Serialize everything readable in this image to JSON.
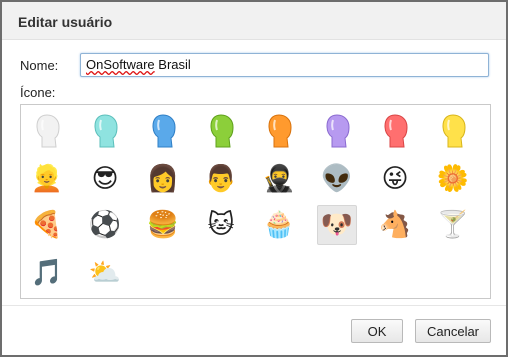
{
  "dialog": {
    "title": "Editar usuário",
    "name_label": "Nome:",
    "name_value_first": "OnSoftware",
    "name_value_rest": " Brasil",
    "icon_label": "Ícone:",
    "ok_label": "OK",
    "cancel_label": "Cancelar"
  },
  "icons": {
    "heads": [
      {
        "name": "avatar-white-head-icon",
        "color": "#f2f2f2",
        "shade": "#cfcfcf"
      },
      {
        "name": "avatar-teal-head-icon",
        "color": "#8fe3e0",
        "shade": "#5cbfbb"
      },
      {
        "name": "avatar-blue-head-icon",
        "color": "#5aa9ea",
        "shade": "#2f7fc6"
      },
      {
        "name": "avatar-green-head-icon",
        "color": "#8ccf3a",
        "shade": "#5fa11c"
      },
      {
        "name": "avatar-orange-head-icon",
        "color": "#ff9a2e",
        "shade": "#d8720c"
      },
      {
        "name": "avatar-purple-head-icon",
        "color": "#b79af0",
        "shade": "#8b6bd0"
      },
      {
        "name": "avatar-red-head-icon",
        "color": "#ff6f6f",
        "shade": "#d94545"
      },
      {
        "name": "avatar-yellow-head-icon",
        "color": "#ffe14a",
        "shade": "#d8b51a"
      }
    ],
    "row2": [
      {
        "name": "blonde-woman-sunglasses-icon",
        "glyph": "👱"
      },
      {
        "name": "cool-guy-cap-icon",
        "glyph": "😎"
      },
      {
        "name": "woman-sunglasses-icon",
        "glyph": "👩"
      },
      {
        "name": "man-portrait-icon",
        "glyph": "👨"
      },
      {
        "name": "ninja-icon",
        "glyph": "🥷"
      },
      {
        "name": "alien-icon",
        "glyph": "👽"
      },
      {
        "name": "laughing-smiley-icon",
        "glyph": "😜"
      },
      {
        "name": "daisy-flower-icon",
        "glyph": "🌼"
      }
    ],
    "row3": [
      {
        "name": "pizza-slice-icon",
        "glyph": "🍕"
      },
      {
        "name": "soccer-ball-icon",
        "glyph": "⚽"
      },
      {
        "name": "hamburger-icon",
        "glyph": "🍔"
      },
      {
        "name": "cat-icon",
        "glyph": "🐱"
      },
      {
        "name": "cupcake-icon",
        "glyph": "🧁"
      },
      {
        "name": "dog-icon",
        "glyph": "🐶"
      },
      {
        "name": "horse-icon",
        "glyph": "🐴"
      },
      {
        "name": "cocktail-glass-icon",
        "glyph": "🍸"
      }
    ],
    "row4": [
      {
        "name": "music-note-icon",
        "glyph": "🎵"
      },
      {
        "name": "sun-behind-cloud-icon",
        "glyph": "⛅"
      }
    ],
    "selected": "dog-icon"
  }
}
